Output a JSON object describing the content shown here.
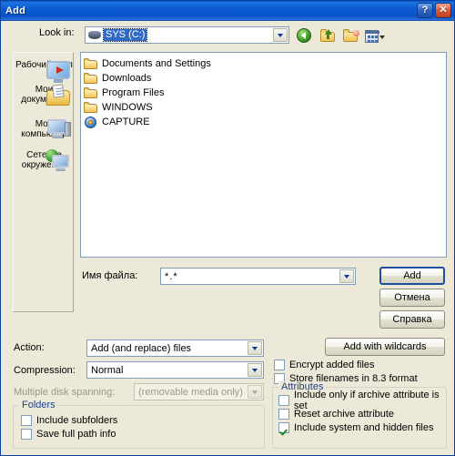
{
  "window": {
    "title": "Add",
    "help_button": "?",
    "close_button": "✕"
  },
  "lookin": {
    "label": "Look in:",
    "value": "SYS (C:)",
    "drive_icon": "hard-drive-icon"
  },
  "toolbar": {
    "back_icon": "back-arrow-icon",
    "up_icon": "up-one-level-icon",
    "newfolder_icon": "new-folder-icon",
    "views_icon": "views-menu-icon"
  },
  "places": {
    "items": [
      {
        "label": "Рабочий стол",
        "icon": "desktop-icon"
      },
      {
        "label": "Мои документы",
        "icon": "my-documents-icon"
      },
      {
        "label": "Мой компьютер",
        "icon": "my-computer-icon"
      },
      {
        "label": "Сетевое окружение",
        "icon": "network-neighborhood-icon"
      }
    ]
  },
  "filelist": {
    "items": [
      {
        "name": "Documents and Settings",
        "icon": "folder-icon"
      },
      {
        "name": "Downloads",
        "icon": "folder-icon"
      },
      {
        "name": "Program Files",
        "icon": "folder-icon"
      },
      {
        "name": "WINDOWS",
        "icon": "folder-icon"
      },
      {
        "name": "CAPTURE",
        "icon": "disc-icon"
      }
    ]
  },
  "filename": {
    "label": "Имя файла:",
    "value": "*.*"
  },
  "buttons": {
    "add": "Add",
    "cancel": "Отмена",
    "help": "Справка",
    "add_with_wildcards": "Add with wildcards"
  },
  "options": {
    "action_label": "Action:",
    "action_value": "Add (and replace) files",
    "compression_label": "Compression:",
    "compression_value": "Normal",
    "spanning_label": "Multiple disk spanning:",
    "spanning_value": "(removable media only)",
    "spanning_disabled": true
  },
  "folders_group": {
    "title": "Folders",
    "checkboxes": [
      {
        "label": "Include subfolders",
        "checked": false
      },
      {
        "label": "Save full path info",
        "checked": false
      }
    ]
  },
  "right_checkboxes": [
    {
      "label": "Encrypt added files",
      "checked": false
    },
    {
      "label": "Store filenames in 8.3 format",
      "checked": false
    }
  ],
  "attributes_group": {
    "title": "Attributes",
    "checkboxes": [
      {
        "label": "Include only if archive attribute is set",
        "checked": false
      },
      {
        "label": "Reset archive attribute",
        "checked": false
      },
      {
        "label": "Include system and hidden files",
        "checked": true
      }
    ]
  },
  "colors": {
    "titlebar_blue": "#0a53c8",
    "dialog_face": "#ece9d8",
    "selection_blue": "#316ac5",
    "group_title": "#1d3f8f",
    "check_green": "#1a8a22"
  }
}
